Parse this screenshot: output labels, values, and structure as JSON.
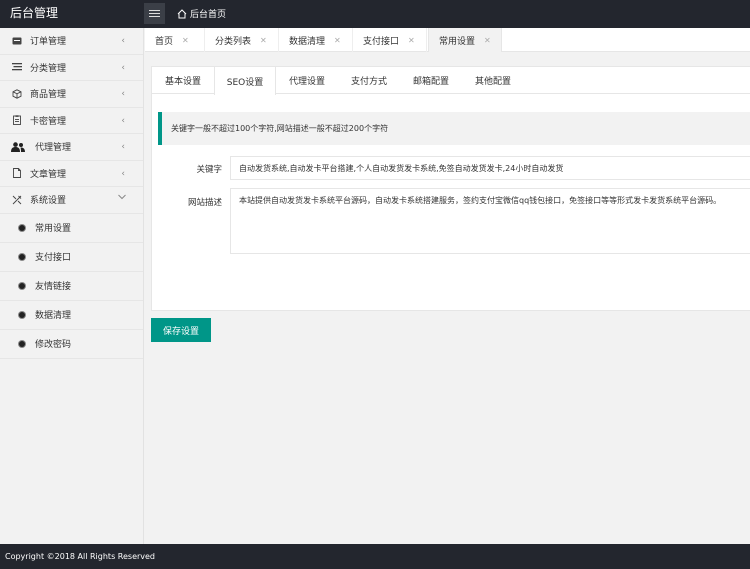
{
  "header": {
    "logo": "后台管理",
    "menu_toggle_icon": "hamburger-icon",
    "home_icon": "home-icon",
    "home_label": "后台首页"
  },
  "sidebar": {
    "items": [
      {
        "label": "订单管理",
        "icon": "order-icon"
      },
      {
        "label": "分类管理",
        "icon": "list-icon"
      },
      {
        "label": "商品管理",
        "icon": "cube-icon"
      },
      {
        "label": "卡密管理",
        "icon": "card-icon"
      },
      {
        "label": "代理管理",
        "icon": "users-icon"
      },
      {
        "label": "文章管理",
        "icon": "document-icon"
      },
      {
        "label": "系统设置",
        "icon": "settings-icon"
      }
    ],
    "sub_items": [
      {
        "label": "常用设置"
      },
      {
        "label": "支付接口"
      },
      {
        "label": "友情链接"
      },
      {
        "label": "数据清理"
      },
      {
        "label": "修改密码"
      }
    ]
  },
  "tabs": [
    {
      "label": "首页"
    },
    {
      "label": "分类列表"
    },
    {
      "label": "数据清理"
    },
    {
      "label": "支付接口"
    },
    {
      "label": "常用设置"
    }
  ],
  "active_tab": "常用设置",
  "subtabs": [
    {
      "label": "基本设置"
    },
    {
      "label": "SEO设置"
    },
    {
      "label": "代理设置"
    },
    {
      "label": "支付方式"
    },
    {
      "label": "邮箱配置"
    },
    {
      "label": "其他配置"
    }
  ],
  "active_subtab": "SEO设置",
  "form": {
    "notice": "关键字一般不超过100个字符,网站描述一般不超过200个字符",
    "keywords_label": "关键字",
    "keywords_value": "自动发货系统,自动发卡平台搭建,个人自动发货发卡系统,免签自动发货发卡,24小时自动发货",
    "description_label": "网站描述",
    "description_value": "本站提供自动发货发卡系统平台源码，自动发卡系统搭建服务，签约支付宝微信qq钱包接口，免签接口等等形式发卡发货系统平台源码。",
    "save_label": "保存设置"
  },
  "footer": {
    "copyright": "Copyright ©2018 All Rights Reserved"
  },
  "colors": {
    "topbar": "#23262e",
    "accent": "#009688",
    "background": "#f2f2f2"
  }
}
